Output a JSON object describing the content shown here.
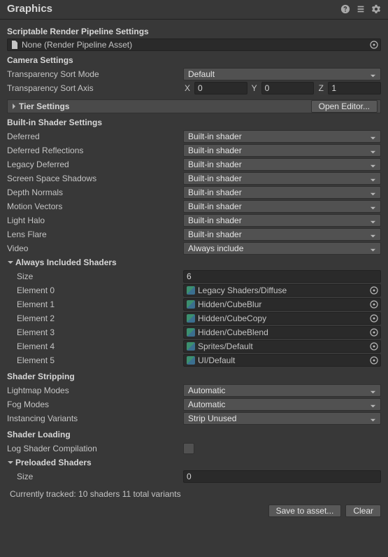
{
  "header": {
    "title": "Graphics"
  },
  "srp": {
    "title": "Scriptable Render Pipeline Settings",
    "asset_label": "None (Render Pipeline Asset)"
  },
  "camera": {
    "title": "Camera Settings",
    "transparency_sort_mode_label": "Transparency Sort Mode",
    "transparency_sort_mode_value": "Default",
    "transparency_sort_axis_label": "Transparency Sort Axis",
    "x_label": "X",
    "x_value": "0",
    "y_label": "Y",
    "y_value": "0",
    "z_label": "Z",
    "z_value": "1"
  },
  "tier": {
    "label": "Tier Settings",
    "open_editor": "Open Editor..."
  },
  "builtin": {
    "title": "Built-in Shader Settings",
    "rows": [
      {
        "label": "Deferred",
        "value": "Built-in shader"
      },
      {
        "label": "Deferred Reflections",
        "value": "Built-in shader"
      },
      {
        "label": "Legacy Deferred",
        "value": "Built-in shader"
      },
      {
        "label": "Screen Space Shadows",
        "value": "Built-in shader"
      },
      {
        "label": "Depth Normals",
        "value": "Built-in shader"
      },
      {
        "label": "Motion Vectors",
        "value": "Built-in shader"
      },
      {
        "label": "Light Halo",
        "value": "Built-in shader"
      },
      {
        "label": "Lens Flare",
        "value": "Built-in shader"
      }
    ],
    "video_label": "Video",
    "video_value": "Always include"
  },
  "included": {
    "title": "Always Included Shaders",
    "size_label": "Size",
    "size_value": "6",
    "elements": [
      {
        "label": "Element 0",
        "value": "Legacy Shaders/Diffuse"
      },
      {
        "label": "Element 1",
        "value": "Hidden/CubeBlur"
      },
      {
        "label": "Element 2",
        "value": "Hidden/CubeCopy"
      },
      {
        "label": "Element 3",
        "value": "Hidden/CubeBlend"
      },
      {
        "label": "Element 4",
        "value": "Sprites/Default"
      },
      {
        "label": "Element 5",
        "value": "UI/Default"
      }
    ]
  },
  "stripping": {
    "title": "Shader Stripping",
    "lightmap_label": "Lightmap Modes",
    "lightmap_value": "Automatic",
    "fog_label": "Fog Modes",
    "fog_value": "Automatic",
    "instancing_label": "Instancing Variants",
    "instancing_value": "Strip Unused"
  },
  "loading": {
    "title": "Shader Loading",
    "log_label": "Log Shader Compilation",
    "preloaded_title": "Preloaded Shaders",
    "size_label": "Size",
    "size_value": "0"
  },
  "tracked": "Currently tracked: 10 shaders 11 total variants",
  "footer": {
    "save": "Save to asset...",
    "clear": "Clear"
  }
}
